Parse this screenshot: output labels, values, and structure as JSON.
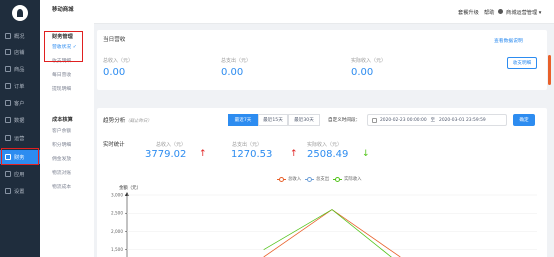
{
  "nav": {
    "items": [
      {
        "label": "概况",
        "icon": "home-icon"
      },
      {
        "label": "店铺",
        "icon": "shop-icon"
      },
      {
        "label": "商品",
        "icon": "goods-icon"
      },
      {
        "label": "订单",
        "icon": "order-icon"
      },
      {
        "label": "客户",
        "icon": "user-icon"
      },
      {
        "label": "数据",
        "icon": "data-icon"
      },
      {
        "label": "运营",
        "icon": "operate-icon"
      },
      {
        "label": "财务",
        "icon": "finance-icon"
      },
      {
        "label": "应用",
        "icon": "app-icon"
      },
      {
        "label": "设置",
        "icon": "settings-icon"
      }
    ]
  },
  "submenu": {
    "title": "移动商城",
    "group1": "财务管理",
    "items1": [
      "营收状况 ✓",
      "收支明细",
      "每日营收",
      "提现明细"
    ],
    "group2": "成本核算",
    "items2": [
      "客户余额",
      "积分明细",
      "佣金发放",
      "物流对账",
      "物流成本"
    ]
  },
  "header": {
    "upgrade": "套餐升级",
    "help": "帮助",
    "user": "商城运营管理 ▾"
  },
  "today": {
    "title": "当日营收",
    "link": "查看数据说明",
    "labels": [
      "总收入（元）",
      "总支出（元）",
      "实际收入（元）"
    ],
    "values": [
      "0.00",
      "0.00",
      "0.00"
    ],
    "btn": "收支明细"
  },
  "trend": {
    "title": "趋势分析",
    "subtitle": "（截止昨日）",
    "ranges": [
      "最近7天",
      "最近15天",
      "最近30天"
    ],
    "custom_label": "自定义时间段：",
    "start": "2020-02-23 00:00:00",
    "sep": "至",
    "end": "2020-03-01 23:59:59",
    "query": "确定",
    "section": "实时统计",
    "labels": [
      "总收入（元）",
      "总支出（元）",
      "实际收入（元）"
    ],
    "values": [
      "3779.02",
      "1270.53",
      "2508.49"
    ],
    "arrows": [
      "↑",
      "↑",
      "↓"
    ],
    "legend": [
      "总收入",
      "总支出",
      "实际收入"
    ]
  },
  "colors": {
    "income": "#e8602a",
    "expense": "#6ea0d8",
    "actual": "#52c41a"
  },
  "chart_data": {
    "type": "line",
    "ylabel": "金额（元）",
    "yticks": [
      "3,000",
      "2,500",
      "2,000",
      "1,500"
    ],
    "ylim": [
      1300,
      3000
    ],
    "x": [
      0,
      1,
      2,
      3,
      4,
      5,
      6
    ],
    "series": [
      {
        "name": "总收入",
        "values": [
          null,
          null,
          1300,
          2600,
          1300,
          null,
          null
        ]
      },
      {
        "name": "实际收入",
        "values": [
          null,
          null,
          1500,
          2600,
          1100,
          null,
          null
        ]
      }
    ]
  }
}
